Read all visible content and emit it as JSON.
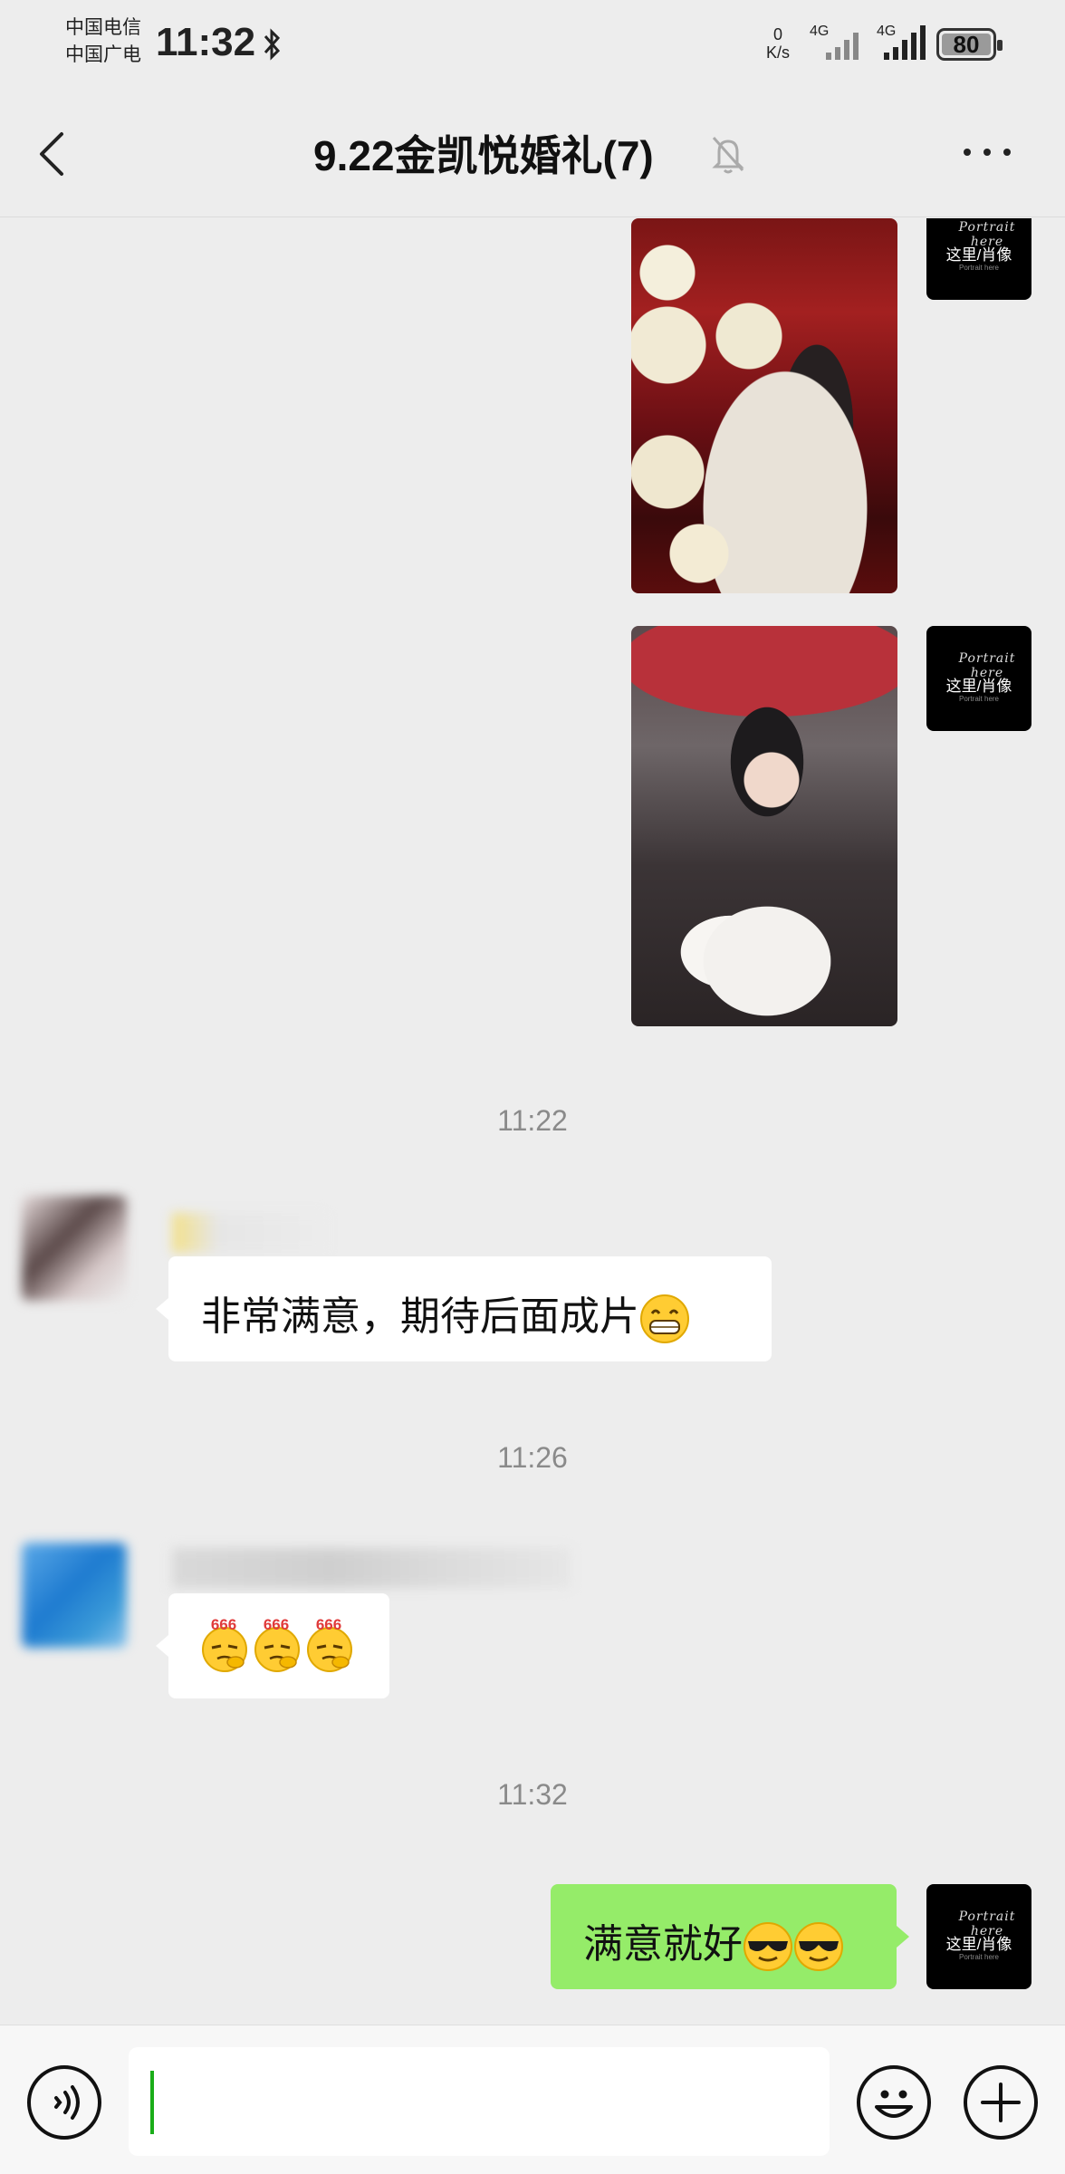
{
  "status_bar": {
    "carrier_1": "中国电信",
    "carrier_2": "中国广电",
    "time": "11:32",
    "net_speed_value": "0",
    "net_speed_unit": "K/s",
    "signal_1_label": "4G",
    "signal_2_label": "4G",
    "battery_level": "80"
  },
  "header": {
    "title": "9.22金凯悦婚礼(7)",
    "muted": true
  },
  "brand_avatar": {
    "script_text": "Portrait here",
    "name": "这里/肖像",
    "sub": "Portrait here"
  },
  "messages": {
    "photo_1": {
      "type": "image",
      "icon": "wedding-couple-photo"
    },
    "photo_2": {
      "type": "image",
      "icon": "bride-portrait-photo"
    },
    "time_1": "11:22",
    "msg_1": {
      "text": "非常满意，期待后面成片",
      "emoji": "grinning-face"
    },
    "time_2": "11:26",
    "msg_2": {
      "emojis": [
        "666-emoji",
        "666-emoji",
        "666-emoji"
      ],
      "emoji_label": "666"
    },
    "time_3": "11:32",
    "msg_3": {
      "text": "满意就好",
      "emojis": [
        "sunglasses-face",
        "sunglasses-face"
      ]
    }
  },
  "input": {
    "value": "",
    "placeholder": ""
  },
  "colors": {
    "background": "#EDEDED",
    "bubble_self": "#95EC69",
    "bubble_other": "#FFFFFF",
    "caret": "#1AAD19"
  }
}
